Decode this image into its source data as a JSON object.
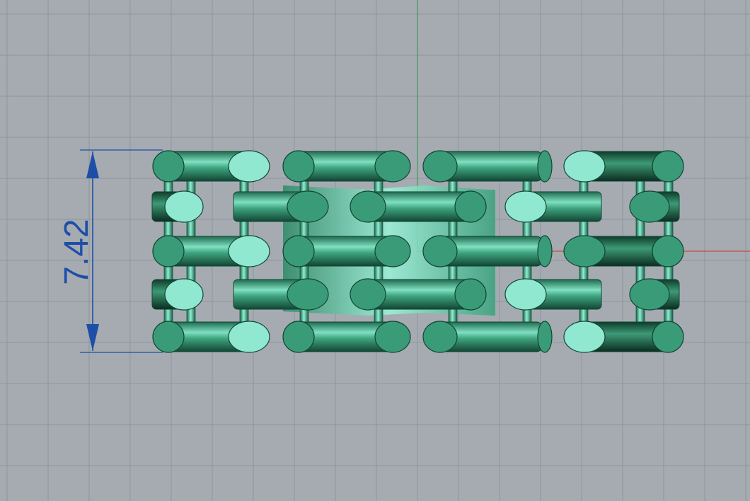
{
  "viewport": {
    "projection": "top view",
    "background_color": "#a6abb2",
    "grid_color": "#8f959c",
    "x_axis_color": "#c8493f",
    "y_axis_color": "#3f9a54"
  },
  "model": {
    "type": "woven-link ring band",
    "color": "#3a9b78",
    "highlight_color": "#8fe8cf",
    "shadow_color": "#134a35"
  },
  "dimension": {
    "value_label": "7.42",
    "orientation": "vertical",
    "color": "#1d4fa8"
  }
}
